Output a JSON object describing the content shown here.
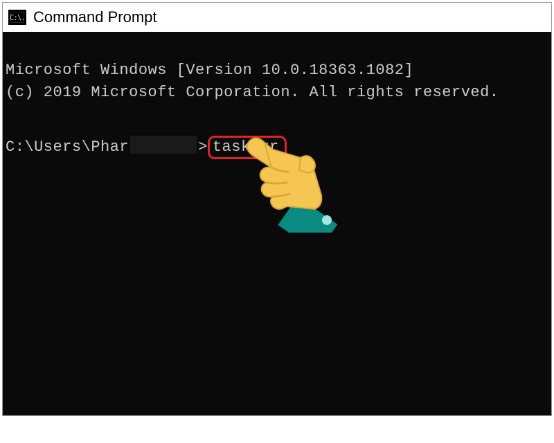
{
  "title_bar": {
    "icon_label": "C:\\.",
    "title": "Command Prompt"
  },
  "terminal": {
    "line1": "Microsoft Windows [Version 10.0.18363.1082]",
    "line2": "(c) 2019 Microsoft Corporation. All rights reserved.",
    "prompt_prefix": "C:\\Users\\Phar",
    "prompt_suffix": ">",
    "command": "taskmgr"
  },
  "annotation": {
    "icon_name": "pointing-hand-icon"
  }
}
